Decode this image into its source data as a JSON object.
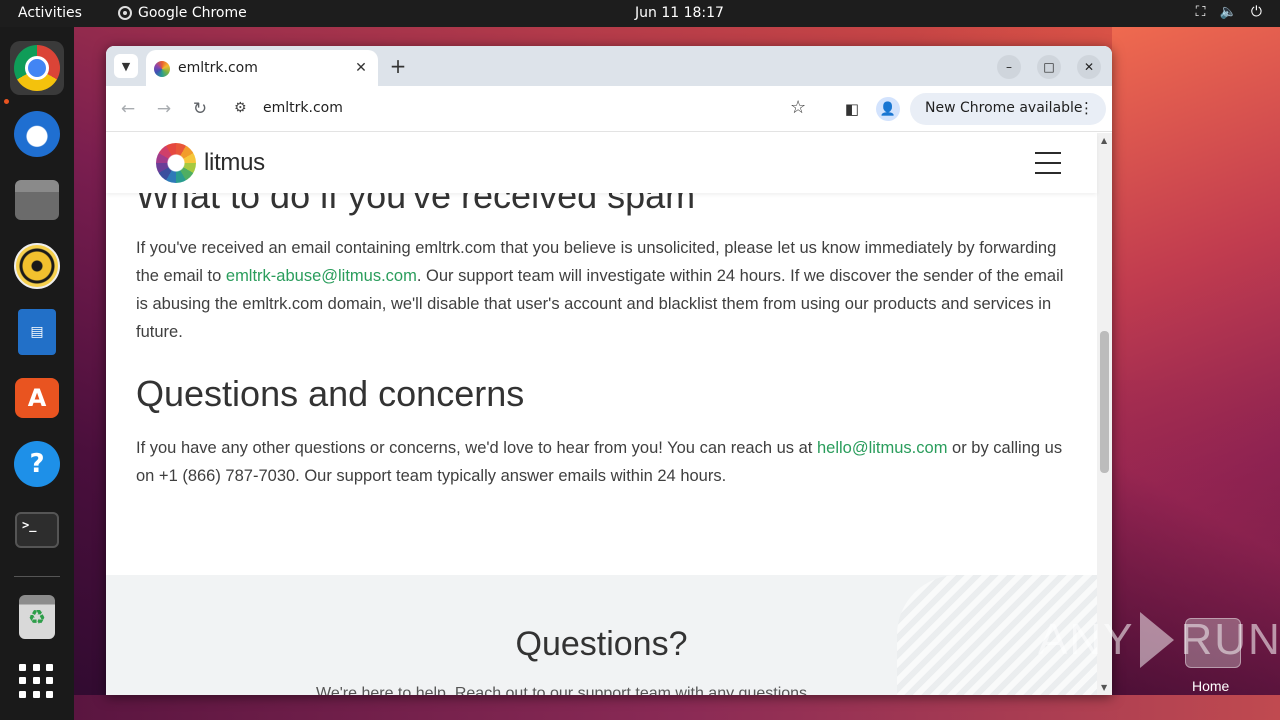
{
  "topbar": {
    "activities": "Activities",
    "app_name": "Google Chrome",
    "clock": "Jun 11  18:17",
    "tray_icons": [
      "network-icon",
      "volume-icon",
      "power-icon"
    ]
  },
  "dock": {
    "items": [
      "chrome-icon",
      "thunderbird-icon",
      "files-icon",
      "rhythmbox-icon",
      "writer-icon",
      "app-center-icon",
      "help-icon",
      "terminal-icon",
      "trash-icon",
      "app-grid-icon"
    ],
    "trash_glyph": "♻",
    "store_glyph": "A",
    "help_glyph": "?",
    "terminal_glyph": ">_"
  },
  "browser": {
    "tab_title": "emltrk.com",
    "tab_close": "✕",
    "new_tab": "+",
    "url": "emltrk.com",
    "update_label": "New Chrome available",
    "back": "←",
    "forward": "→",
    "reload": "↻",
    "star": "☆",
    "minimize": "–",
    "maximize": "□",
    "close": "✕"
  },
  "page": {
    "logo_text": "litmus",
    "heading_spam": "What to do if you've received spam",
    "para_spam_1": "If you've received an email containing emltrk.com that you believe is unsolicited, please let us know immediately by forwarding the email to ",
    "spam_link": "emltrk-abuse@litmus.com",
    "para_spam_2": ". Our support team will investigate within 24 hours. If we discover the sender of the email is abusing the emltrk.com domain, we'll disable that user's account and blacklist them from using our products and services in future.",
    "heading_questions": "Questions and concerns",
    "para_q_1": "If you have any other questions or concerns, we'd love to hear from you! You can reach us at ",
    "q_link": "hello@litmus.com",
    "para_q_2": " or by calling us on +1 (866) 787-7030. Our support team typically answer emails within 24 hours.",
    "footer_title": "Questions?",
    "footer_cut": "We're here to help. Reach out to our support team with any questions."
  },
  "desktop": {
    "watermark": "ANY",
    "watermark_end": "RUN",
    "home_label": "Home"
  },
  "colors": {
    "link": "#2a9d5c",
    "ubuntu_accent": "#e95420"
  }
}
